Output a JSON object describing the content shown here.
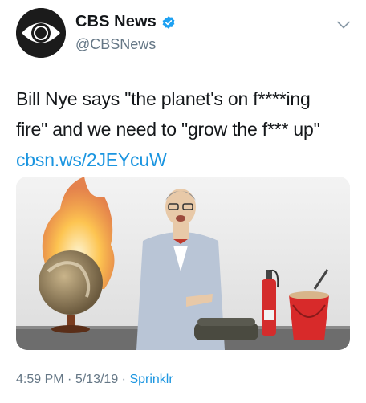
{
  "tweet": {
    "display_name": "CBS News",
    "handle": "@CBSNews",
    "text_line1": "Bill Nye says \"the planet's on f****ing",
    "text_line2": "fire\" and we need to \"grow the f*** up\"",
    "link": "cbsn.ws/2JEYcuW",
    "time": "4:59 PM",
    "separator": "·",
    "date": "5/13/19",
    "source": "Sprinklr"
  },
  "icons": {
    "avatar": "cbs-eye-logo",
    "verified": "verified-badge-icon",
    "menu": "chevron-down-icon"
  },
  "colors": {
    "link": "#1b95e0",
    "secondary_text": "#657786",
    "primary_text": "#14171a",
    "verified": "#1da1f2"
  }
}
